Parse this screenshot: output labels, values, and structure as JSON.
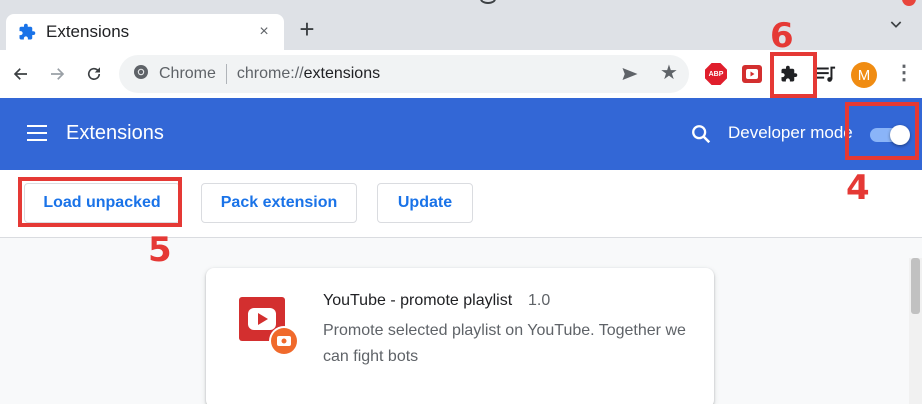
{
  "tab": {
    "title": "Extensions",
    "icon": "puzzle-icon",
    "close": "×"
  },
  "newtab": "+",
  "omnibox": {
    "site_label": "Chrome",
    "url_prefix": "chrome://",
    "url_path": "extensions"
  },
  "toolbar_extensions": [
    "adblock-plus-icon",
    "youtube-extension-icon",
    "puzzle-icon",
    "playlist-icon"
  ],
  "abp_text": "ABP",
  "avatar_letter": "M",
  "header": {
    "title": "Extensions",
    "developer_mode_label": "Developer mode",
    "developer_mode_on": true
  },
  "actions": {
    "load_unpacked": "Load unpacked",
    "pack_extension": "Pack extension",
    "update": "Update"
  },
  "extension_card": {
    "name": "YouTube - promote playlist",
    "version": "1.0",
    "description": "Promote selected playlist on YouTube. Together we can fight bots"
  },
  "annotations": [
    "6",
    "4",
    "5"
  ],
  "colors": {
    "header_blue": "#3367d6",
    "accent_blue": "#1a73e8",
    "annotation_red": "#e53935",
    "youtube_red": "#e62117"
  }
}
